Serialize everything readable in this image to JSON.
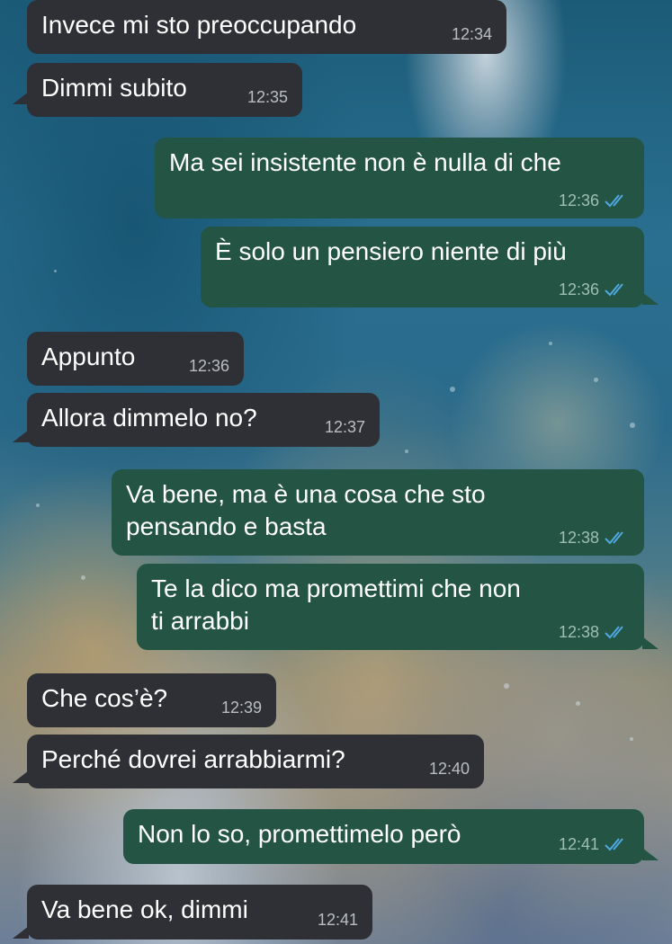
{
  "colors": {
    "incoming_bubble": "#2e3035",
    "outgoing_bubble": "#235444",
    "read_ticks": "#4fa8e0"
  },
  "messages": [
    {
      "direction": "in",
      "text": "Invece mi sto preoccupando",
      "time": "12:34"
    },
    {
      "direction": "in",
      "text": "Dimmi subito",
      "time": "12:35"
    },
    {
      "direction": "out",
      "text": "Ma sei insistente non è nulla di che",
      "time": "12:36",
      "status": "read-ticks-icon"
    },
    {
      "direction": "out",
      "text": "È solo un pensiero niente di più",
      "time": "12:36",
      "status": "read-ticks-icon"
    },
    {
      "direction": "in",
      "text": "Appunto",
      "time": "12:36"
    },
    {
      "direction": "in",
      "text": "Allora dimmelo no?",
      "time": "12:37"
    },
    {
      "direction": "out",
      "text": "Va bene, ma è una cosa che sto\npensando e basta",
      "time": "12:38",
      "status": "read-ticks-icon"
    },
    {
      "direction": "out",
      "text": "Te la dico ma promettimi che non\nti arrabbi",
      "time": "12:38",
      "status": "read-ticks-icon"
    },
    {
      "direction": "in",
      "text": "Che cos’è?",
      "time": "12:39"
    },
    {
      "direction": "in",
      "text": "Perché dovrei arrabbiarmi?",
      "time": "12:40"
    },
    {
      "direction": "out",
      "text": "Non lo so, promettimelo però",
      "time": "12:41",
      "status": "read-ticks-icon"
    },
    {
      "direction": "in",
      "text": "Va bene ok, dimmi",
      "time": "12:41"
    }
  ]
}
